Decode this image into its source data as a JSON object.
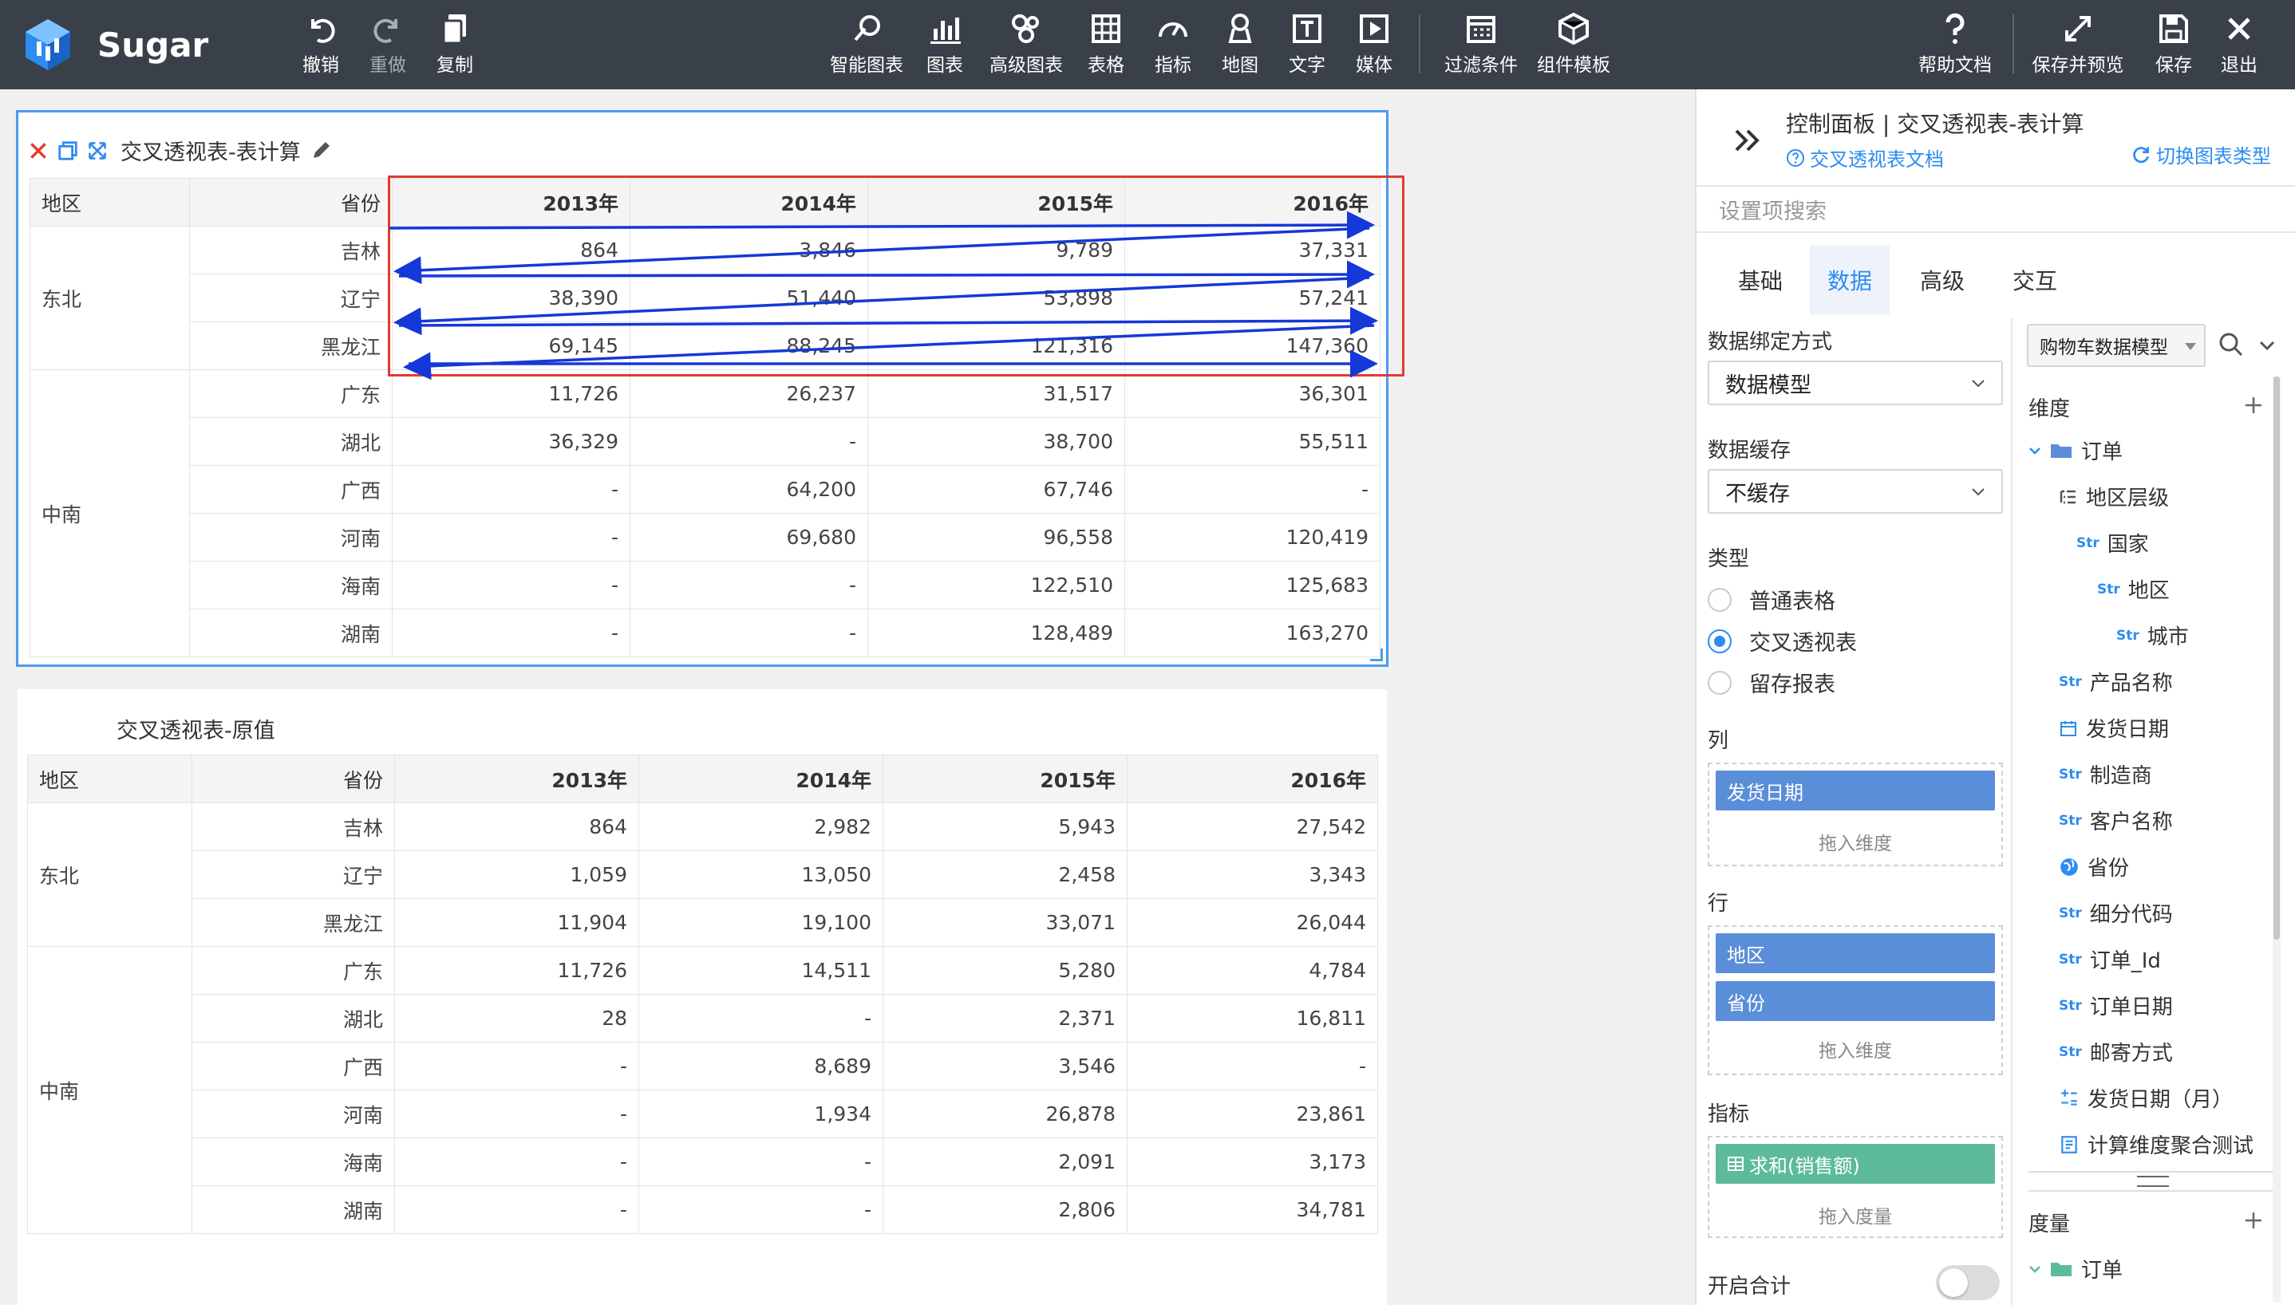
{
  "app": {
    "name": "Sugar"
  },
  "toolbar": {
    "left": [
      {
        "key": "undo",
        "label": "撤销"
      },
      {
        "key": "redo",
        "label": "重做"
      },
      {
        "key": "copy",
        "label": "复制"
      }
    ],
    "center": [
      {
        "key": "smart-chart",
        "label": "智能图表"
      },
      {
        "key": "chart",
        "label": "图表"
      },
      {
        "key": "advanced-chart",
        "label": "高级图表"
      },
      {
        "key": "table",
        "label": "表格"
      },
      {
        "key": "indicator",
        "label": "指标"
      },
      {
        "key": "map",
        "label": "地图"
      },
      {
        "key": "text",
        "label": "文字"
      },
      {
        "key": "media",
        "label": "媒体"
      },
      {
        "key": "filter",
        "label": "过滤条件"
      },
      {
        "key": "template",
        "label": "组件模板"
      }
    ],
    "right": [
      {
        "key": "help",
        "label": "帮助文档"
      },
      {
        "key": "save-preview",
        "label": "保存并预览"
      },
      {
        "key": "save",
        "label": "保存"
      },
      {
        "key": "exit",
        "label": "退出"
      }
    ]
  },
  "widget1": {
    "title": "交叉透视表-表计算",
    "headers": [
      "地区",
      "省份",
      "2013年",
      "2014年",
      "2015年",
      "2016年"
    ],
    "groups": [
      {
        "region": "东北",
        "rows": [
          {
            "province": "吉林",
            "values": [
              "864",
              "3,846",
              "9,789",
              "37,331"
            ]
          },
          {
            "province": "辽宁",
            "values": [
              "38,390",
              "51,440",
              "53,898",
              "57,241"
            ]
          },
          {
            "province": "黑龙江",
            "values": [
              "69,145",
              "88,245",
              "121,316",
              "147,360"
            ]
          }
        ]
      },
      {
        "region": "中南",
        "rows": [
          {
            "province": "广东",
            "values": [
              "11,726",
              "26,237",
              "31,517",
              "36,301"
            ]
          },
          {
            "province": "湖北",
            "values": [
              "36,329",
              "-",
              "38,700",
              "55,511"
            ]
          },
          {
            "province": "广西",
            "values": [
              "-",
              "64,200",
              "67,746",
              "-"
            ]
          },
          {
            "province": "河南",
            "values": [
              "-",
              "69,680",
              "96,558",
              "120,419"
            ]
          },
          {
            "province": "海南",
            "values": [
              "-",
              "-",
              "122,510",
              "125,683"
            ]
          },
          {
            "province": "湖南",
            "values": [
              "-",
              "-",
              "128,489",
              "163,270"
            ]
          }
        ]
      }
    ]
  },
  "widget2": {
    "title": "交叉透视表-原值",
    "headers": [
      "地区",
      "省份",
      "2013年",
      "2014年",
      "2015年",
      "2016年"
    ],
    "groups": [
      {
        "region": "东北",
        "rows": [
          {
            "province": "吉林",
            "values": [
              "864",
              "2,982",
              "5,943",
              "27,542"
            ]
          },
          {
            "province": "辽宁",
            "values": [
              "1,059",
              "13,050",
              "2,458",
              "3,343"
            ]
          },
          {
            "province": "黑龙江",
            "values": [
              "11,904",
              "19,100",
              "33,071",
              "26,044"
            ]
          }
        ]
      },
      {
        "region": "中南",
        "rows": [
          {
            "province": "广东",
            "values": [
              "11,726",
              "14,511",
              "5,280",
              "4,784"
            ]
          },
          {
            "province": "湖北",
            "values": [
              "28",
              "-",
              "2,371",
              "16,811"
            ]
          },
          {
            "province": "广西",
            "values": [
              "-",
              "8,689",
              "3,546",
              "-"
            ]
          },
          {
            "province": "河南",
            "values": [
              "-",
              "1,934",
              "26,878",
              "23,861"
            ]
          },
          {
            "province": "海南",
            "values": [
              "-",
              "-",
              "2,091",
              "3,173"
            ]
          },
          {
            "province": "湖南",
            "values": [
              "-",
              "-",
              "2,806",
              "34,781"
            ]
          }
        ]
      }
    ]
  },
  "panel": {
    "title": "控制面板 | 交叉透视表-表计算",
    "doc_link": "交叉透视表文档",
    "switch_type": "切换图表类型",
    "search_placeholder": "设置项搜索",
    "tabs": [
      "基础",
      "数据",
      "高级",
      "交互"
    ],
    "active_tab": "数据",
    "binding_label": "数据绑定方式",
    "binding_value": "数据模型",
    "cache_label": "数据缓存",
    "cache_value": "不缓存",
    "type_label": "类型",
    "types": [
      {
        "label": "普通表格",
        "checked": false
      },
      {
        "label": "交叉透视表",
        "checked": true
      },
      {
        "label": "留存报表",
        "checked": false
      }
    ],
    "col_label": "列",
    "col_chip": "发货日期",
    "drop_dim": "拖入维度",
    "row_label": "行",
    "row_chips": [
      "地区",
      "省份"
    ],
    "measure_label": "指标",
    "measure_chip": "求和(销售额)",
    "drop_measure": "拖入度量",
    "total_label": "开启合计",
    "total_on": false,
    "model_select": "购物车数据模型",
    "dim_label": "维度",
    "measure_section": "度量",
    "tree": [
      {
        "label": "订单",
        "type": "folder",
        "level": 0
      },
      {
        "label": "地区层级",
        "type": "hier",
        "level": 1
      },
      {
        "label": "国家",
        "type": "str",
        "level": 2
      },
      {
        "label": "地区",
        "type": "str",
        "level": 3
      },
      {
        "label": "城市",
        "type": "str",
        "level": 4
      },
      {
        "label": "产品名称",
        "type": "str",
        "level": 1
      },
      {
        "label": "发货日期",
        "type": "date",
        "level": 1
      },
      {
        "label": "制造商",
        "type": "str",
        "level": 1
      },
      {
        "label": "客户名称",
        "type": "str",
        "level": 1
      },
      {
        "label": "省份",
        "type": "geo",
        "level": 1
      },
      {
        "label": "细分代码",
        "type": "str",
        "level": 1
      },
      {
        "label": "订单_Id",
        "type": "str",
        "level": 1
      },
      {
        "label": "订单日期",
        "type": "str",
        "level": 1
      },
      {
        "label": "邮寄方式",
        "type": "str",
        "level": 1
      },
      {
        "label": "发货日期（月）",
        "type": "calc",
        "level": 1
      },
      {
        "label": "计算维度聚合测试",
        "type": "calcd",
        "level": 1
      }
    ],
    "measure_tree": [
      {
        "label": "订单",
        "type": "folder",
        "level": 0
      }
    ],
    "str_tag": "Str"
  },
  "colors": {
    "accent": "#2d8cf0",
    "topbar": "#394049",
    "highlight": "#e23b2e",
    "arrow": "#1538d8",
    "chip_blue": "#5b8ed8",
    "chip_green": "#5dba9b"
  }
}
